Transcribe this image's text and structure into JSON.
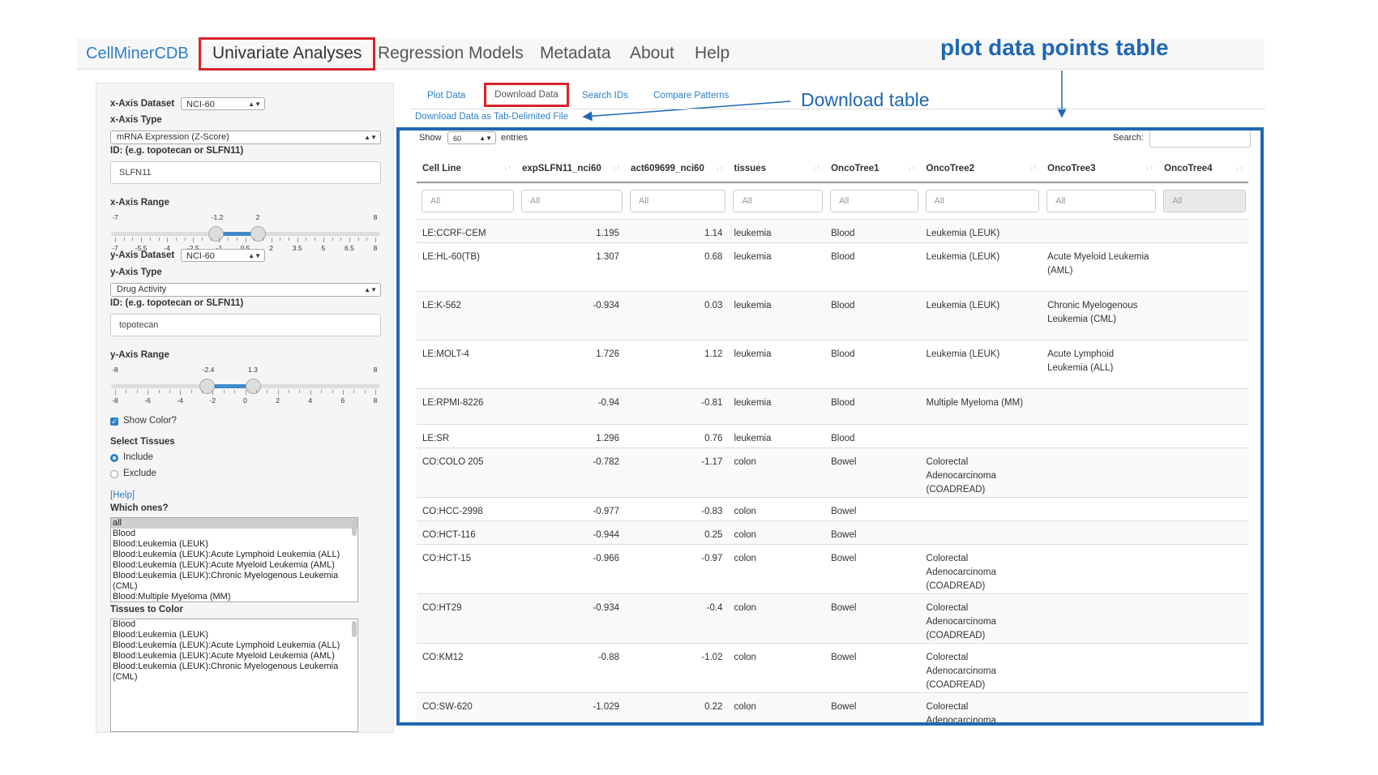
{
  "nav": {
    "brand": "CellMinerCDB",
    "items": [
      "Univariate Analyses",
      "Regression Models",
      "Metadata",
      "About",
      "Help"
    ]
  },
  "annotations": {
    "plot_table": "plot data points table",
    "download_table": "Download table"
  },
  "colors": {
    "accent": "#2f7fc8",
    "highlight_red": "#d9242b",
    "panel_blue": "#1f67b3"
  },
  "sidebar": {
    "x_dataset_label": "x-Axis Dataset",
    "x_dataset_value": "NCI-60",
    "x_type_label": "x-Axis Type",
    "x_type_value": "mRNA Expression (Z-Score)",
    "x_id_label": "ID: (e.g. topotecan or SLFN11)",
    "x_id_value": "SLFN11",
    "x_range_label": "x-Axis Range",
    "x_range": {
      "min": "-7",
      "max": "8",
      "low": "-1.2",
      "high": "2",
      "ticks": [
        "-7",
        "-5.5",
        "-4",
        "-2.5",
        "-1",
        "0.5",
        "2",
        "3.5",
        "5",
        "6.5",
        "8"
      ]
    },
    "y_dataset_label": "y-Axis Dataset",
    "y_dataset_value": "NCI-60",
    "y_type_label": "y-Axis Type",
    "y_type_value": "Drug Activity",
    "y_id_label": "ID: (e.g. topotecan or SLFN11)",
    "y_id_value": "topotecan",
    "y_range_label": "y-Axis Range",
    "y_range": {
      "min": "-8",
      "max": "8",
      "low": "-2.4",
      "high": "1.3",
      "ticks": [
        "-8",
        "-6",
        "-4",
        "-2",
        "0",
        "2",
        "4",
        "6",
        "8"
      ]
    },
    "show_color_label": "Show Color?",
    "select_tissues_label": "Select Tissues",
    "include_label": "Include",
    "exclude_label": "Exclude",
    "help_link": "[Help]",
    "which_ones_label": "Which ones?",
    "which_ones_items": [
      "all",
      "Blood",
      "Blood:Leukemia (LEUK)",
      "Blood:Leukemia (LEUK):Acute Lymphoid Leukemia (ALL)",
      "Blood:Leukemia (LEUK):Acute Myeloid Leukemia (AML)",
      "Blood:Leukemia (LEUK):Chronic Myelogenous Leukemia",
      "(CML)",
      "Blood:Multiple Myeloma (MM)"
    ],
    "tissues_color_label": "Tissues to Color",
    "tissues_color_items": [
      "Blood",
      "Blood:Leukemia (LEUK)",
      "Blood:Leukemia (LEUK):Acute Lymphoid Leukemia (ALL)",
      "Blood:Leukemia (LEUK):Acute Myeloid Leukemia (AML)",
      "Blood:Leukemia (LEUK):Chronic Myelogenous Leukemia",
      "(CML)"
    ]
  },
  "tabs": [
    "Plot Data",
    "Download Data",
    "Search IDs",
    "Compare Patterns"
  ],
  "download_link": "Download Data as Tab-Delimited File",
  "table": {
    "show_label": "Show",
    "show_value": "60",
    "entries_label": "entries",
    "search_label": "Search:",
    "filter_placeholder": "All",
    "columns": [
      "Cell Line",
      "expSLFN11_nci60",
      "act609699_nci60",
      "tissues",
      "OncoTree1",
      "OncoTree2",
      "OncoTree3",
      "OncoTree4"
    ],
    "rows": [
      [
        "LE:CCRF-CEM",
        "1.195",
        "1.14",
        "leukemia",
        "Blood",
        "Leukemia (LEUK)",
        "",
        ""
      ],
      [
        "LE:HL-60(TB)",
        "1.307",
        "0.68",
        "leukemia",
        "Blood",
        "Leukemia (LEUK)",
        "Acute Myeloid Leukemia (AML)",
        ""
      ],
      [
        "LE:K-562",
        "-0.934",
        "0.03",
        "leukemia",
        "Blood",
        "Leukemia (LEUK)",
        "Chronic Myelogenous Leukemia (CML)",
        ""
      ],
      [
        "LE:MOLT-4",
        "1.726",
        "1.12",
        "leukemia",
        "Blood",
        "Leukemia (LEUK)",
        "Acute Lymphoid Leukemia (ALL)",
        ""
      ],
      [
        "LE:RPMI-8226",
        "-0.94",
        "-0.81",
        "leukemia",
        "Blood",
        "Multiple Myeloma (MM)",
        "",
        ""
      ],
      [
        "LE:SR",
        "1.296",
        "0.76",
        "leukemia",
        "Blood",
        "",
        "",
        ""
      ],
      [
        "CO:COLO 205",
        "-0.782",
        "-1.17",
        "colon",
        "Bowel",
        "Colorectal Adenocarcinoma (COADREAD)",
        "",
        ""
      ],
      [
        "CO:HCC-2998",
        "-0.977",
        "-0.83",
        "colon",
        "Bowel",
        "",
        "",
        ""
      ],
      [
        "CO:HCT-116",
        "-0.944",
        "0.25",
        "colon",
        "Bowel",
        "",
        "",
        ""
      ],
      [
        "CO:HCT-15",
        "-0.966",
        "-0.97",
        "colon",
        "Bowel",
        "Colorectal Adenocarcinoma (COADREAD)",
        "",
        ""
      ],
      [
        "CO:HT29",
        "-0.934",
        "-0.4",
        "colon",
        "Bowel",
        "Colorectal Adenocarcinoma (COADREAD)",
        "",
        ""
      ],
      [
        "CO:KM12",
        "-0.88",
        "-1.02",
        "colon",
        "Bowel",
        "Colorectal Adenocarcinoma (COADREAD)",
        "",
        ""
      ],
      [
        "CO:SW-620",
        "-1.029",
        "0.22",
        "colon",
        "Bowel",
        "Colorectal Adenocarcinoma (COADREAD)",
        "",
        ""
      ]
    ]
  }
}
